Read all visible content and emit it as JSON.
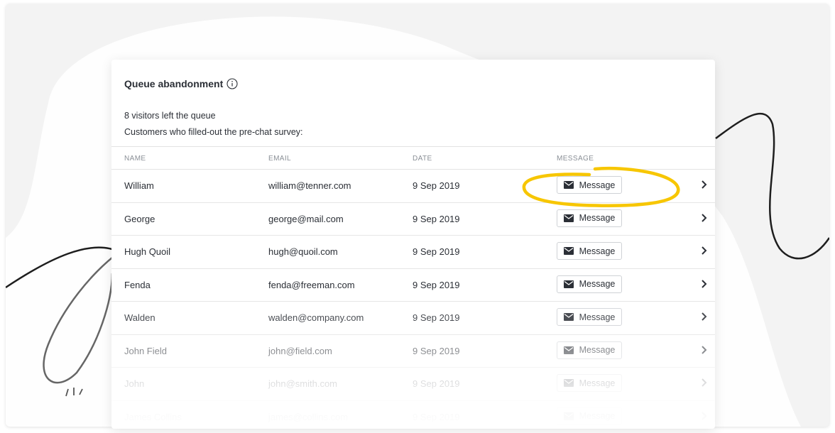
{
  "card": {
    "title": "Queue abandonment",
    "summary": "8 visitors left the queue",
    "subtitle": "Customers who filled-out the pre-chat survey:"
  },
  "table": {
    "headers": {
      "name": "NAME",
      "email": "EMAIL",
      "date": "DATE",
      "message": "MESSAGE"
    },
    "rows": [
      {
        "name": "William",
        "email": "william@tenner.com",
        "date": "9 Sep 2019",
        "button": "Message"
      },
      {
        "name": "George",
        "email": "george@mail.com",
        "date": "9 Sep 2019",
        "button": "Message"
      },
      {
        "name": "Hugh Quoil",
        "email": "hugh@quoil.com",
        "date": "9 Sep 2019",
        "button": "Message"
      },
      {
        "name": "Fenda",
        "email": "fenda@freeman.com",
        "date": "9 Sep 2019",
        "button": "Message"
      },
      {
        "name": "Walden",
        "email": "walden@company.com",
        "date": "9 Sep 2019",
        "button": "Message"
      },
      {
        "name": "John Field",
        "email": "john@field.com",
        "date": "9 Sep 2019",
        "button": "Message"
      },
      {
        "name": "John",
        "email": "john@smith.com",
        "date": "9 Sep 2019",
        "button": "Message"
      },
      {
        "name": "James Collins",
        "email": "james@collins.com",
        "date": "9 Sep 2019",
        "button": "Message"
      }
    ]
  },
  "icons": {
    "info": "info-icon",
    "envelope": "envelope-icon",
    "chevron": "chevron-right-icon"
  },
  "colors": {
    "highlight": "#f7c600",
    "text": "#2b2f36",
    "muted": "#8a8f96"
  }
}
